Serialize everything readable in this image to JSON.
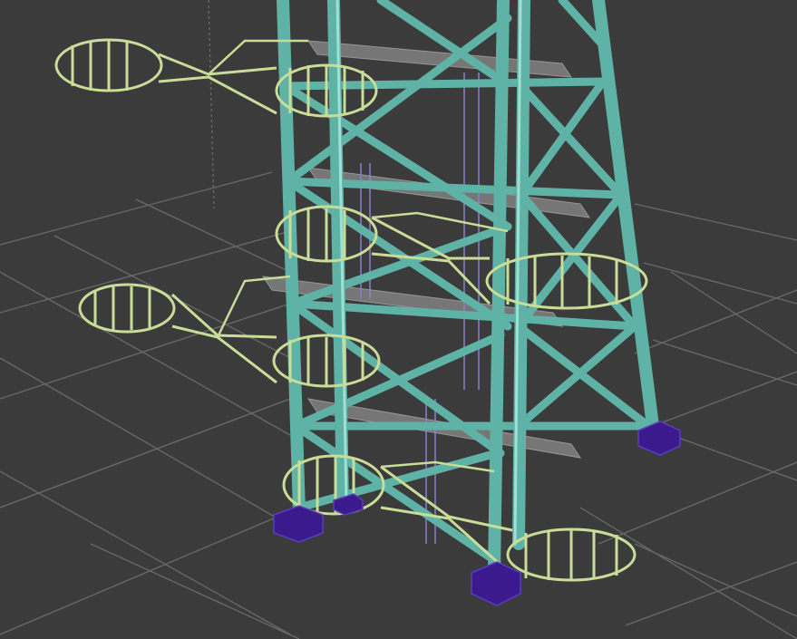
{
  "viewport": {
    "background_color": "#3b3b3b",
    "grid_color": "#6a6a6a",
    "member_color": "#5fb3a6",
    "member_highlight": "#9fe0d4",
    "cage_color": "#c9dc98",
    "base_color": "#3a1a8c",
    "platform_color": "#8a8a8a",
    "ladder_color": "#8f7fd0"
  }
}
